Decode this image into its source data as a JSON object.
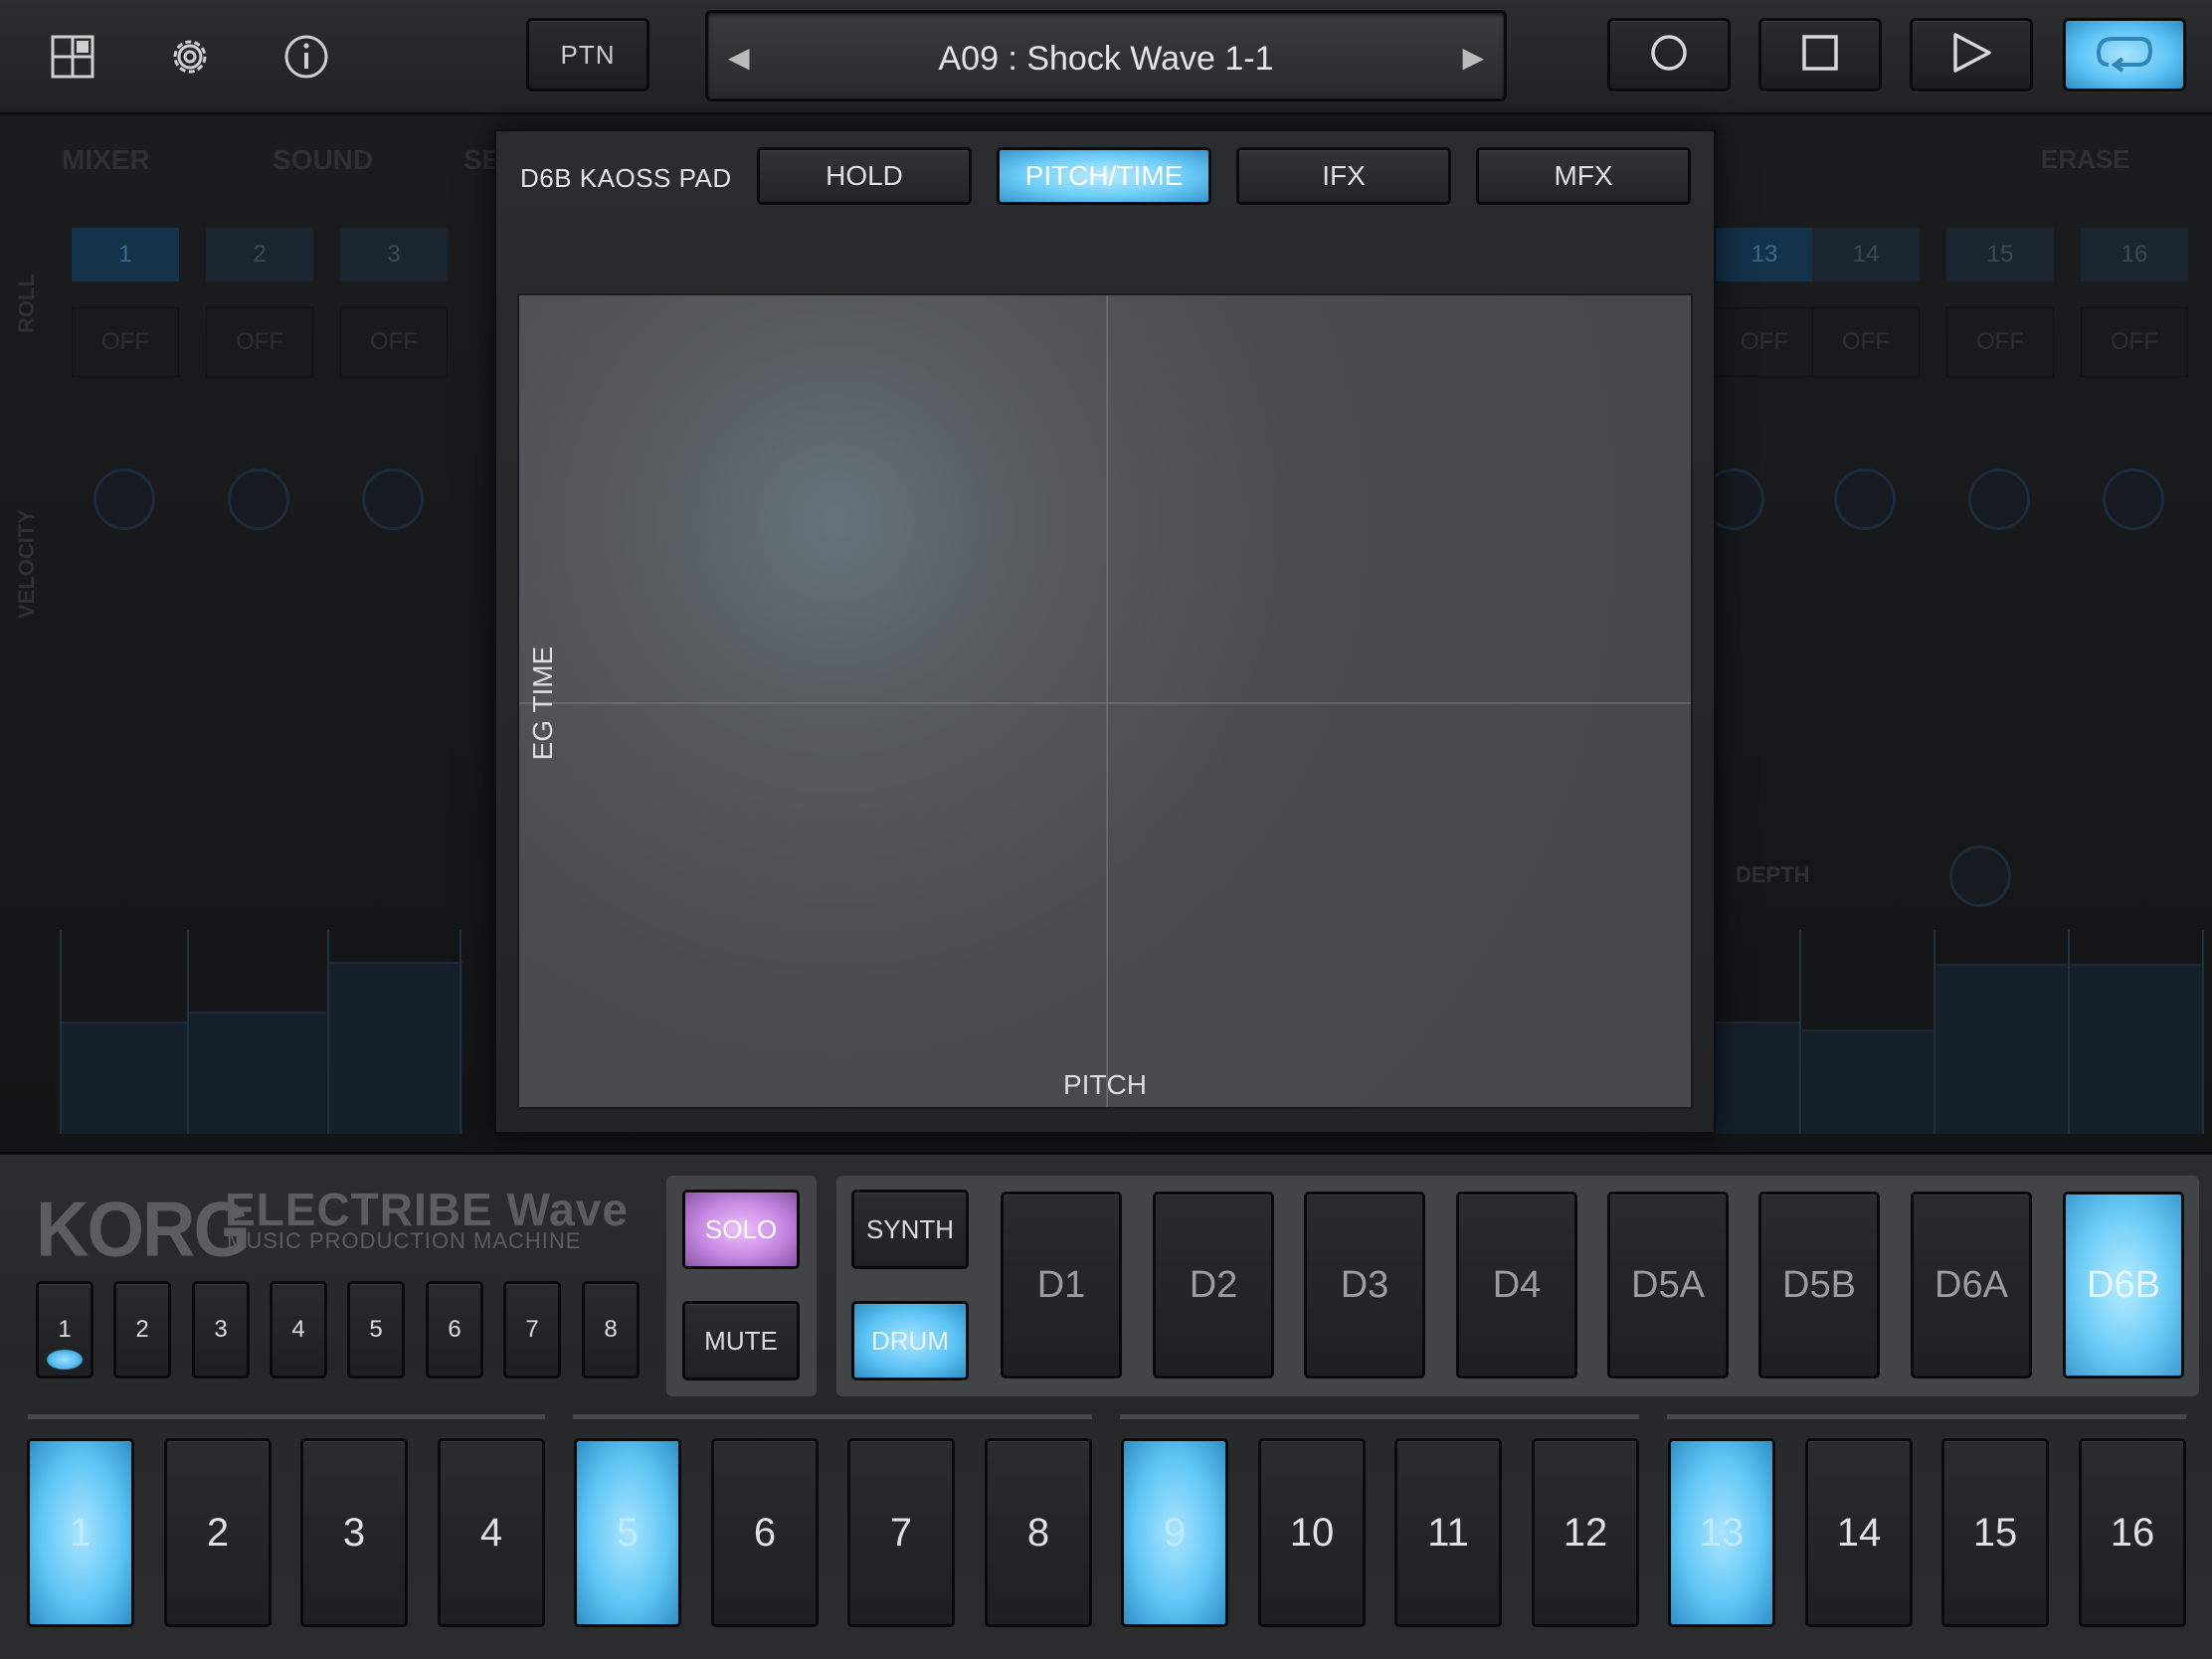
{
  "topbar": {
    "icons": [
      "grid-icon",
      "gear-icon",
      "info-icon"
    ],
    "ptn_label": "PTN",
    "pattern_name": "A09 : Shock Wave 1-1",
    "transport": [
      "record-icon",
      "stop-icon",
      "play-icon",
      "loop-icon"
    ],
    "loop_active": true
  },
  "background": {
    "tabs": [
      "MIXER",
      "SOUND",
      "SE"
    ],
    "erase_label": "ERASE",
    "roll_label": "ROLL",
    "velocity_label": "VELOCITY",
    "depth_label": "DEPTH",
    "left_channels": [
      "1",
      "2",
      "3"
    ],
    "right_channels": [
      "13",
      "14",
      "15",
      "16"
    ],
    "roll_values": [
      "OFF",
      "OFF",
      "OFF",
      "OFF",
      "OFF",
      "OFF",
      "OFF"
    ]
  },
  "kaoss": {
    "title": "D6B KAOSS PAD",
    "buttons": [
      "HOLD",
      "PITCH/TIME",
      "IFX",
      "MFX"
    ],
    "active_button": "PITCH/TIME",
    "y_axis_label": "EG TIME",
    "x_axis_label": "PITCH"
  },
  "brand": {
    "logo": "KORG",
    "model": "ELECTRIBE Wave",
    "tagline": "MUSIC PRODUCTION MACHINE"
  },
  "pages": [
    "1",
    "2",
    "3",
    "4",
    "5",
    "6",
    "7",
    "8"
  ],
  "current_page": "1",
  "solo_label": "SOLO",
  "mute_label": "MUTE",
  "synth_label": "SYNTH",
  "drum_label": "DRUM",
  "parts": [
    "D1",
    "D2",
    "D3",
    "D4",
    "D5A",
    "D5B",
    "D6A",
    "D6B"
  ],
  "active_part": "D6B",
  "steps": [
    "1",
    "2",
    "3",
    "4",
    "5",
    "6",
    "7",
    "8",
    "9",
    "10",
    "11",
    "12",
    "13",
    "14",
    "15",
    "16"
  ],
  "active_steps": [
    "1",
    "5",
    "9",
    "13"
  ],
  "colors": {
    "accent_blue": "#5ec4f5",
    "solo_purple": "#c487e0",
    "background": "#171819"
  }
}
